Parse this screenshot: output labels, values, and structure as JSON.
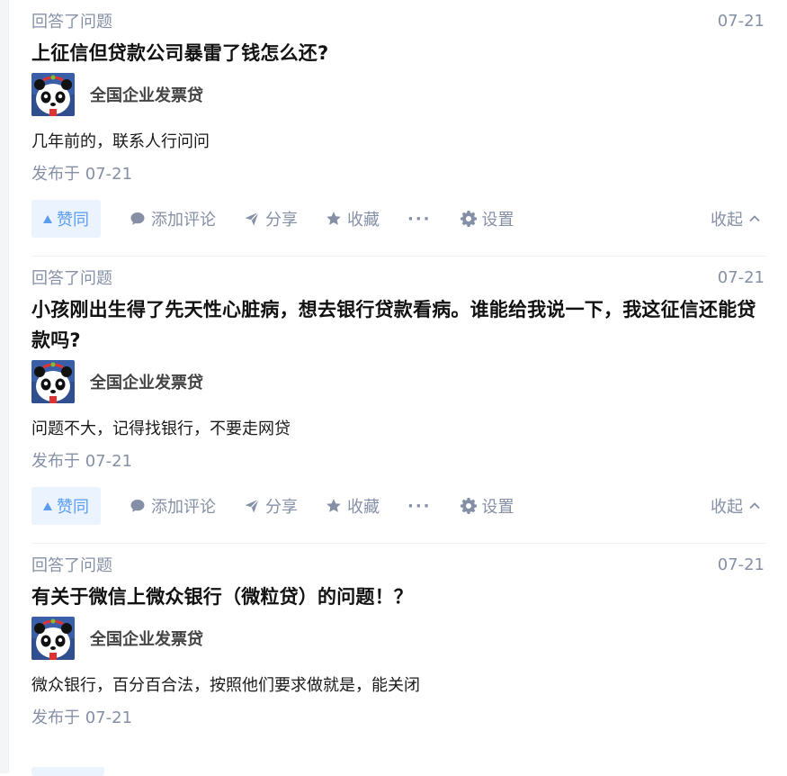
{
  "feed": {
    "items": [
      {
        "activity": "回答了问题",
        "date": "07-21",
        "title": "上征信但贷款公司暴雷了钱怎么还?",
        "author": "全国企业发票贷",
        "answer": "几年前的，联系人行问问",
        "published": "发布于 07-21",
        "actions": {
          "vote": "赞同",
          "comment": "添加评论",
          "share": "分享",
          "favorite": "收藏",
          "more": "···",
          "settings": "设置",
          "collapse": "收起"
        }
      },
      {
        "activity": "回答了问题",
        "date": "07-21",
        "title": "小孩刚出生得了先天性心脏病，想去银行贷款看病。谁能给我说一下，我这征信还能贷款吗?",
        "author": "全国企业发票贷",
        "answer": "问题不大，记得找银行，不要走网贷",
        "published": "发布于 07-21",
        "actions": {
          "vote": "赞同",
          "comment": "添加评论",
          "share": "分享",
          "favorite": "收藏",
          "more": "···",
          "settings": "设置",
          "collapse": "收起"
        }
      },
      {
        "activity": "回答了问题",
        "date": "07-21",
        "title": "有关于微信上微众银行（微粒贷）的问题！？",
        "author": "全国企业发票贷",
        "answer": "微众银行，百分百合法，按照他们要求做就是，能关闭",
        "published": "发布于 07-21"
      }
    ]
  },
  "colors": {
    "accent": "#5b9bf0",
    "accent_bg": "#eaf3fe",
    "meta_gray": "#8590a6",
    "title": "#121212"
  },
  "icons": {
    "comment": "comment-bubble-icon",
    "share": "paper-plane-icon",
    "favorite": "star-icon",
    "settings": "gear-icon",
    "collapse": "chevron-up-icon",
    "avatar": "panda-avatar"
  }
}
